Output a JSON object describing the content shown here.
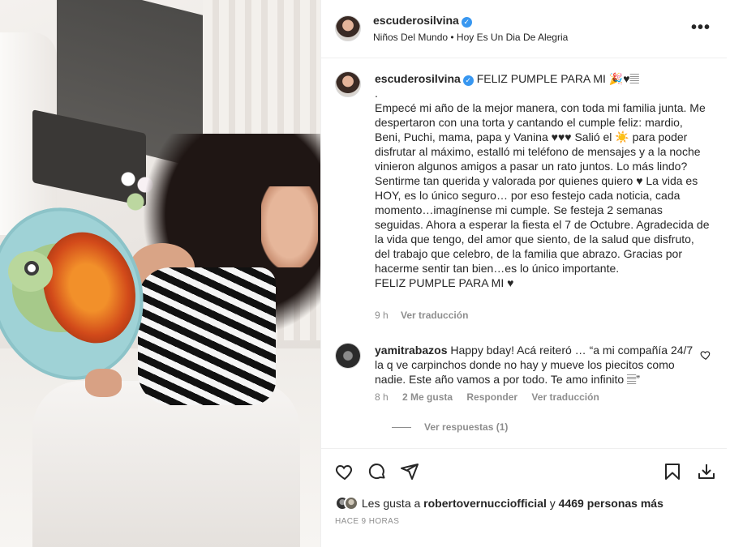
{
  "post": {
    "author": "escuderosilvina",
    "verified_mark": "✓",
    "music": "Niños Del Mundo • Hoy Es Un Dia De Alegria",
    "more_label": "•••"
  },
  "caption": {
    "author": "escuderosilvina",
    "first_line": "FELIZ PUMPLE PARA MI 🎉♥𝄚",
    "body": ".\nEmpecé mi año de la mejor manera, con toda mi familia junta. Me despertaron con una torta y cantando el cumple feliz: mardio, Beni, Puchi, mama, papa y Vanina ♥♥♥ Salió el ☀️ para poder disfrutar al máximo, estalló mi teléfono de mensajes y a la noche vinieron algunos amigos a pasar un rato juntos. Lo más lindo? Sentirme tan querida y valorada por quienes quiero ♥ La vida es HOY, es lo único seguro… por eso festejo cada noticia, cada momento…imagínense mi cumple. Se festeja 2 semanas seguidas. Ahora a esperar la fiesta el 7 de Octubre. Agradecida de la vida que tengo, del amor que siento, de la salud que disfruto, del trabajo que celebro, de la familia que abrazo. Gracias por hacerme sentir tan bien…es lo único importante.\nFELIZ PUMPLE PARA MI ♥",
    "time": "9 h",
    "translate": "Ver traducción"
  },
  "comment": {
    "author": "yamitrabazos",
    "text": "Happy bday! Acá reiteró … “a mi compañía 24/7 la q ve carpinchos donde no hay y mueve los piecitos como nadie. Este año vamos a por todo. Te amo infinito 𝄚”",
    "time": "8 h",
    "likes": "2 Me gusta",
    "reply": "Responder",
    "translate": "Ver traducción",
    "view_replies": "Ver respuestas (1)"
  },
  "footer": {
    "likes_prefix": "Les gusta a",
    "liker": "robertovernucciofficial",
    "likes_connector": "y",
    "likes_rest": "4469 personas más",
    "timestamp": "HACE 9 HORAS"
  },
  "icons": [
    "heart-icon",
    "comment-icon",
    "share-icon",
    "bookmark-icon",
    "download-icon",
    "verified-icon",
    "more-icon"
  ],
  "colors": {
    "verified": "#3897f0",
    "muted": "#8e8e8e",
    "text": "#262626"
  }
}
